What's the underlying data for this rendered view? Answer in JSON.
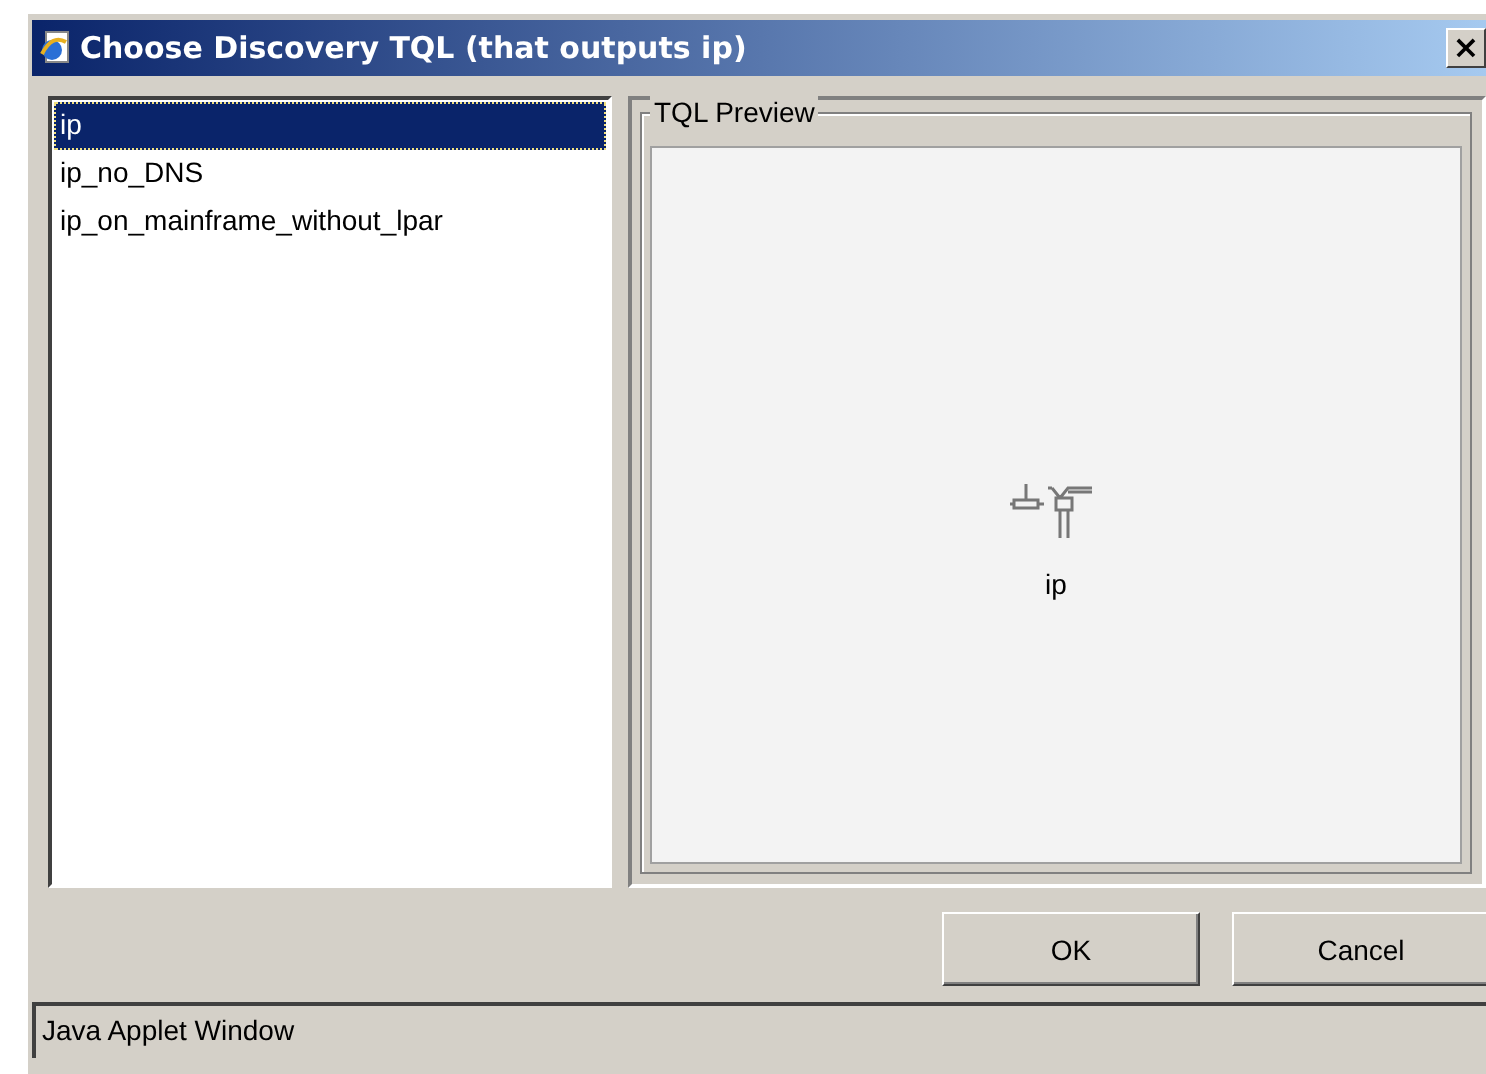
{
  "window": {
    "title": "Choose Discovery TQL (that outputs ip)",
    "close": "×"
  },
  "list": {
    "items": [
      {
        "label": "ip",
        "selected": true
      },
      {
        "label": "ip_no_DNS",
        "selected": false
      },
      {
        "label": "ip_on_mainframe_without_lpar",
        "selected": false
      }
    ]
  },
  "preview": {
    "title": "TQL Preview",
    "node": {
      "label": "ip"
    }
  },
  "buttons": [
    "OK",
    "Cancel"
  ],
  "status_bar": "Java Applet Window"
}
